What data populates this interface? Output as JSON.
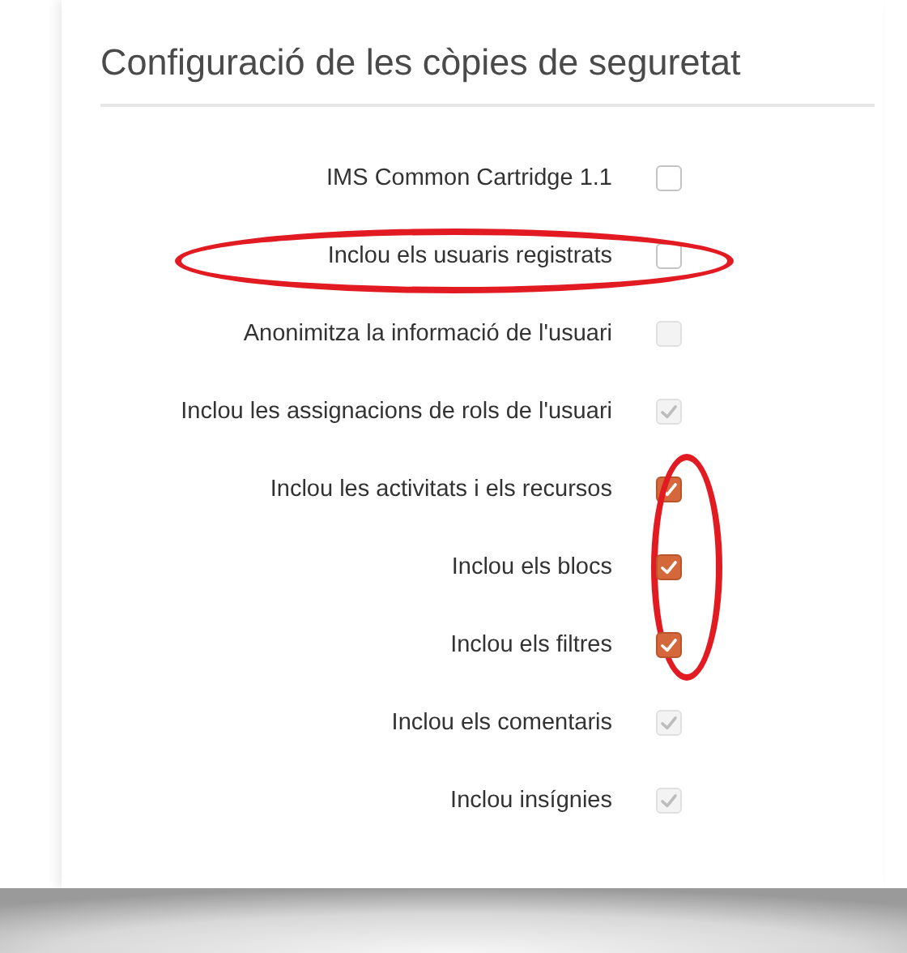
{
  "title": "Configuració de les còpies de seguretat",
  "settings": [
    {
      "label": "IMS Common Cartridge 1.1",
      "checked": false,
      "disabled": false,
      "row_circled": false,
      "checkbox_circled": false
    },
    {
      "label": "Inclou els usuaris registrats",
      "checked": false,
      "disabled": false,
      "row_circled": true,
      "checkbox_circled": false
    },
    {
      "label": "Anonimitza la informació de l'usuari",
      "checked": false,
      "disabled": true,
      "row_circled": false,
      "checkbox_circled": false
    },
    {
      "label": "Inclou les assignacions de rols de l'usuari",
      "checked": true,
      "disabled": true,
      "row_circled": false,
      "checkbox_circled": false
    },
    {
      "label": "Inclou les activitats i els recursos",
      "checked": true,
      "disabled": false,
      "row_circled": false,
      "checkbox_circled": true
    },
    {
      "label": "Inclou els blocs",
      "checked": true,
      "disabled": false,
      "row_circled": false,
      "checkbox_circled": true
    },
    {
      "label": "Inclou els filtres",
      "checked": true,
      "disabled": false,
      "row_circled": false,
      "checkbox_circled": true
    },
    {
      "label": "Inclou els comentaris",
      "checked": true,
      "disabled": true,
      "row_circled": false,
      "checkbox_circled": false
    },
    {
      "label": "Inclou insígnies",
      "checked": true,
      "disabled": true,
      "row_circled": false,
      "checkbox_circled": false
    }
  ]
}
